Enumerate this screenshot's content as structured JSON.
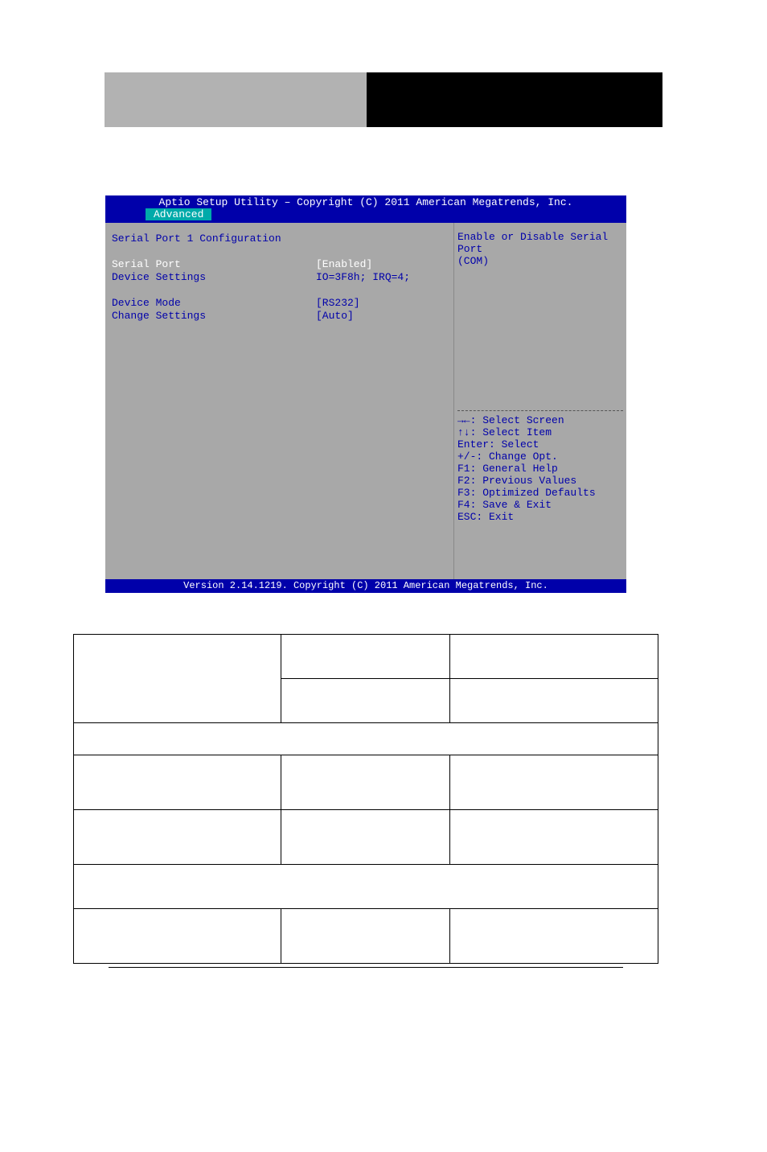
{
  "bios": {
    "header": "Aptio Setup Utility – Copyright (C) 2011 American Megatrends, Inc.",
    "tab": "Advanced",
    "section_title": "Serial Port 1 Configuration",
    "rows": {
      "serial_port_label": "Serial Port",
      "serial_port_value": "[Enabled]",
      "device_settings_label": "Device Settings",
      "device_settings_value": "IO=3F8h; IRQ=4;",
      "device_mode_label": "Device Mode",
      "device_mode_value": "[RS232]",
      "change_settings_label": "Change Settings",
      "change_settings_value": "[Auto]"
    },
    "help": {
      "desc1": "Enable or Disable Serial Port",
      "desc2": "(COM)",
      "k1": "→←: Select Screen",
      "k2": "↑↓: Select Item",
      "k3": "Enter: Select",
      "k4": "+/-: Change Opt.",
      "k5": "F1: General Help",
      "k6": "F2: Previous Values",
      "k7": "F3: Optimized Defaults",
      "k8": "F4: Save & Exit",
      "k9": "ESC: Exit"
    },
    "footer": "Version 2.14.1219. Copyright (C) 2011 American Megatrends, Inc."
  }
}
